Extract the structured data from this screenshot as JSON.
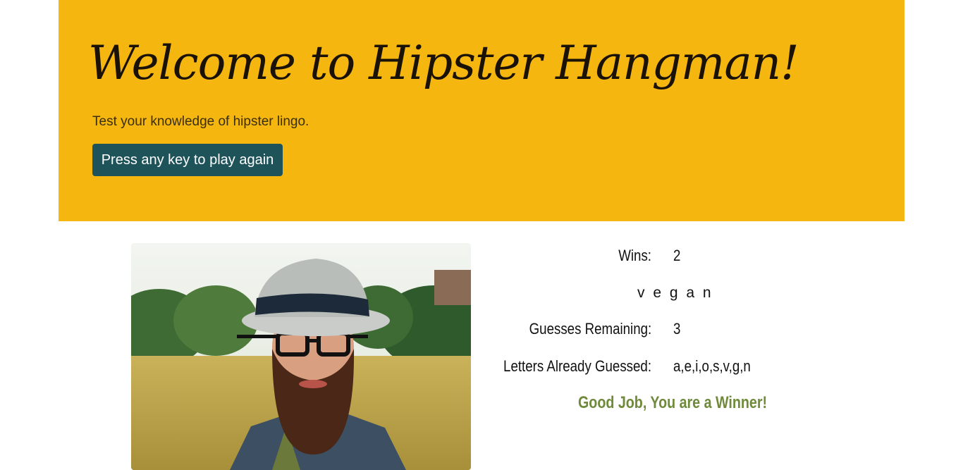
{
  "header": {
    "title": "Welcome to Hipster Hangman!",
    "subtitle": "Test your knowledge of hipster lingo.",
    "play_button_label": "Press any key to play again"
  },
  "image": {
    "subject": "bearded-man-in-hat-photo"
  },
  "stats": {
    "wins_label": "Wins:",
    "wins_value": "2",
    "word_display": "v e g a n",
    "guesses_label": "Guesses Remaining:",
    "guesses_value": "3",
    "letters_label": "Letters Already Guessed:",
    "letters_value": "a,e,i,o,s,v,g,n",
    "result_message": "Good Job, You are a Winner!"
  },
  "colors": {
    "header_bg": "#f5b70f",
    "button_bg": "#1e535a",
    "winner_text": "#6f8a3a"
  }
}
